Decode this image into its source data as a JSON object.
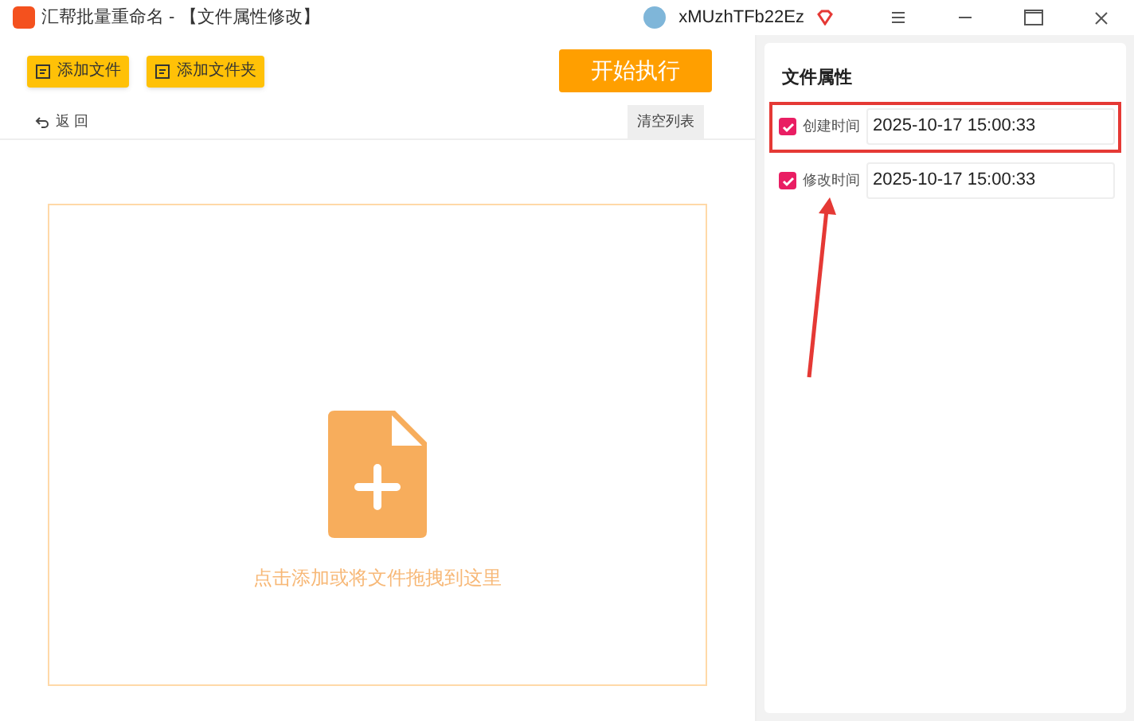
{
  "window": {
    "title": "汇帮批量重命名 - 【文件属性修改】",
    "username": "xMUzhTFb22Ez"
  },
  "toolbar": {
    "buttons": [
      "添加文件",
      "添加文件夹"
    ],
    "start": "开始执行"
  },
  "subbar": {
    "back": "返 回",
    "clear": "清空列表"
  },
  "dropzone": {
    "hint": "点击添加或将文件拖拽到这里"
  },
  "panel": {
    "title": "文件属性",
    "rows": [
      {
        "label": "创建时间",
        "checked": true,
        "value": "2025-10-17 15:00:33",
        "highlighted": true
      },
      {
        "label": "修改时间",
        "checked": true,
        "value": "2025-10-17 15:00:33",
        "highlighted": false
      }
    ]
  }
}
